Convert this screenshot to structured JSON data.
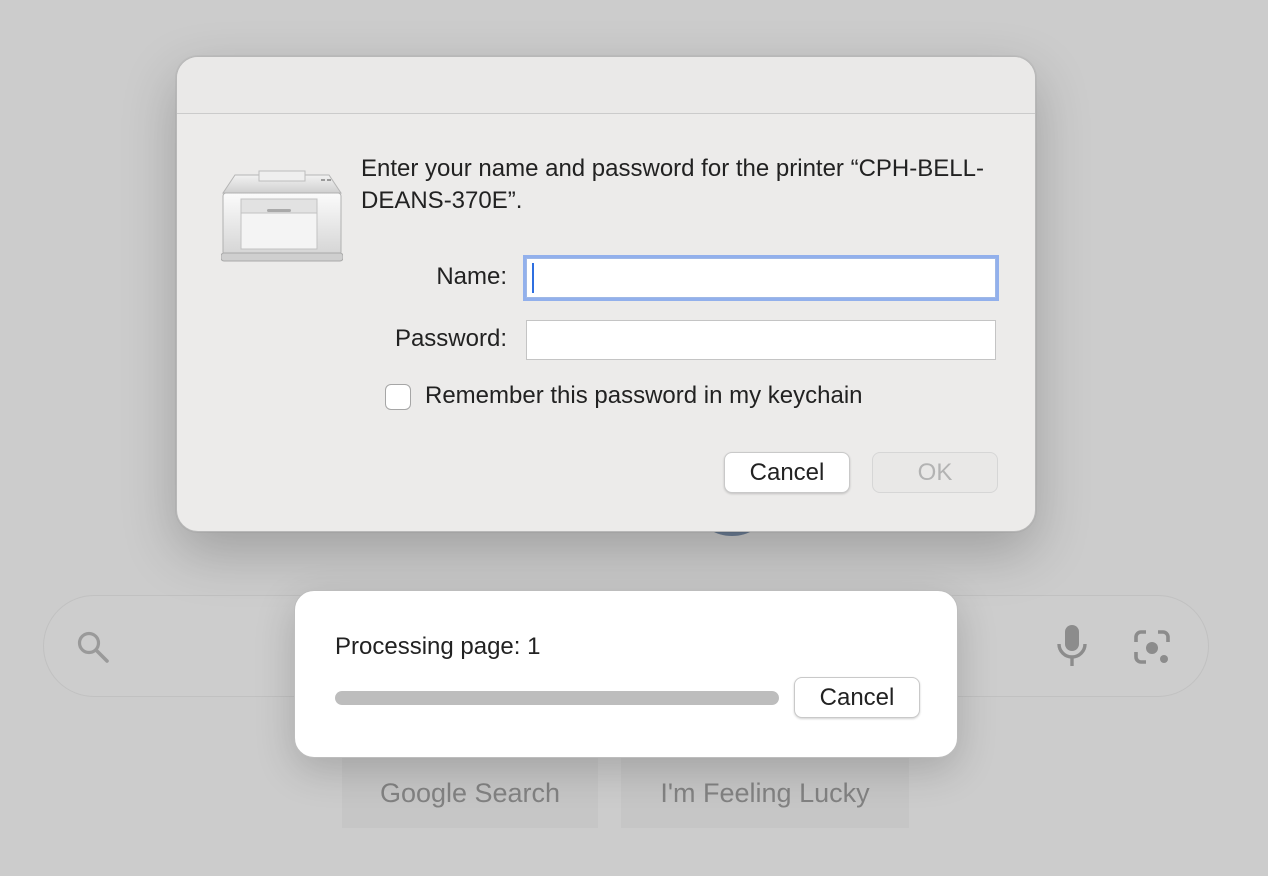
{
  "background": {
    "search_bar": {
      "search_icon": "search-icon",
      "mic_icon": "microphone-icon",
      "lens_icon": "camera-lens-icon"
    },
    "buttons": {
      "google_search": "Google Search",
      "feeling_lucky": "I'm Feeling Lucky"
    }
  },
  "password_dialog": {
    "icon": "printer-icon",
    "message": "Enter your name and password for the printer “CPH-BELL-DEANS-370E”.",
    "name_label": "Name:",
    "name_value": "",
    "password_label": "Password:",
    "password_value": "",
    "remember_label": "Remember this password in my keychain",
    "remember_checked": false,
    "cancel_label": "Cancel",
    "ok_label": "OK",
    "ok_enabled": false
  },
  "progress_sheet": {
    "status": "Processing page: 1",
    "progress_fraction": 1.0,
    "cancel_label": "Cancel"
  },
  "colors": {
    "focus_ring": "#92b0ec",
    "caret": "#2f6fe0"
  }
}
